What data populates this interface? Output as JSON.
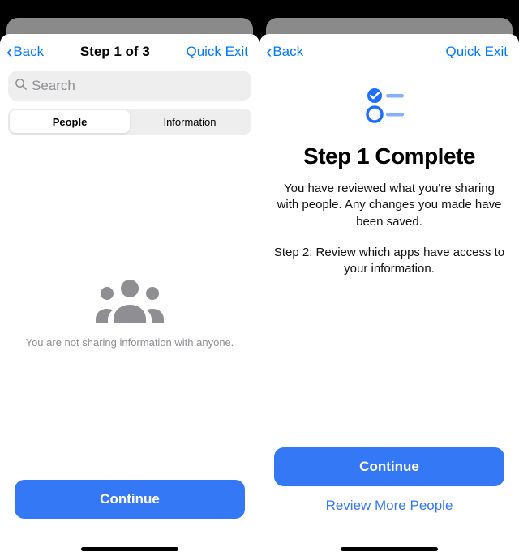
{
  "left": {
    "nav": {
      "back": "Back",
      "title": "Step 1 of 3",
      "quick_exit": "Quick Exit"
    },
    "search": {
      "placeholder": "Search"
    },
    "segment": {
      "people": "People",
      "information": "Information"
    },
    "empty": "You are not sharing information with anyone.",
    "continue": "Continue"
  },
  "right": {
    "nav": {
      "back": "Back",
      "quick_exit": "Quick Exit"
    },
    "title": "Step 1 Complete",
    "body1": "You have reviewed what you're sharing with people. Any changes you made have been saved.",
    "body2": "Step 2: Review which apps have access to your information.",
    "continue": "Continue",
    "review_more": "Review More People"
  },
  "colors": {
    "accent": "#3478f6",
    "link": "#007aff"
  }
}
